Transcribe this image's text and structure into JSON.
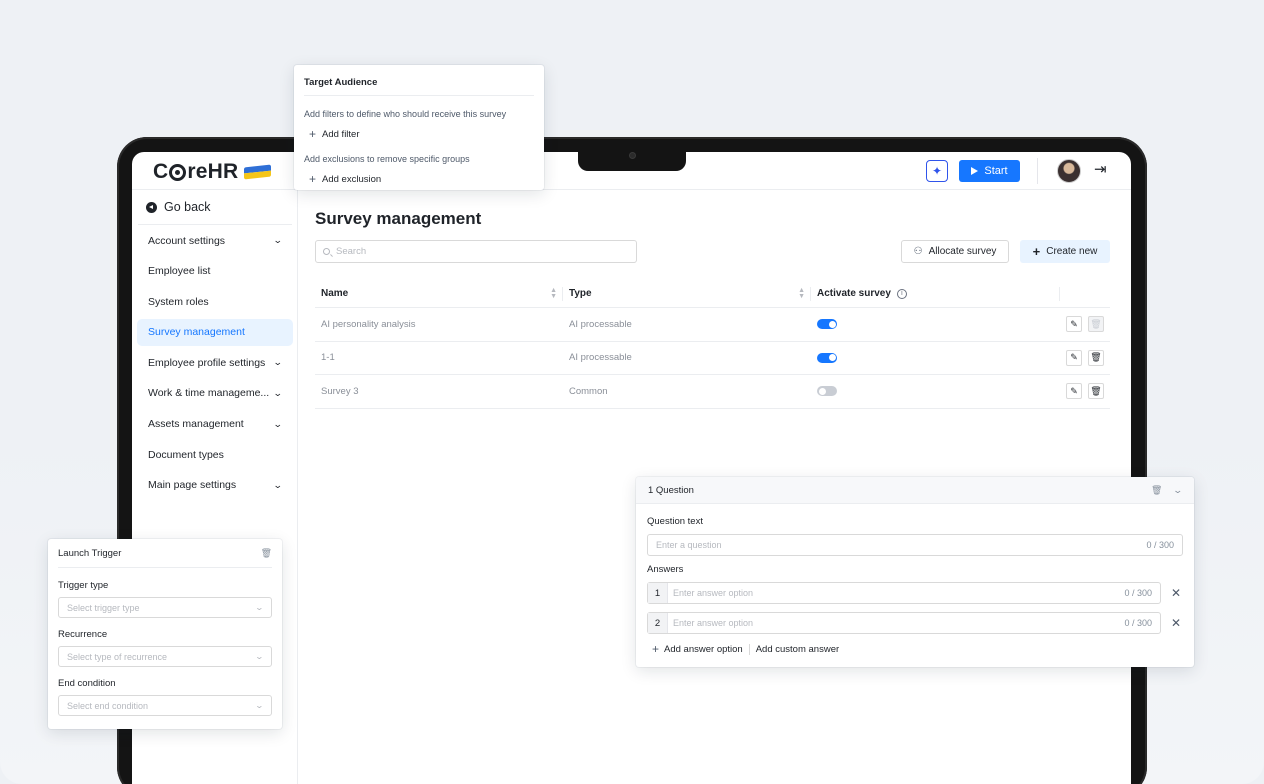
{
  "app": {
    "logo_text_prefix": "C",
    "logo_text_suffix": "reHR"
  },
  "header": {
    "ai_icon": "sparkle-icon",
    "start_label": "Start",
    "logout_icon": "logout-icon"
  },
  "sidebar": {
    "go_back": "Go back",
    "items": [
      {
        "label": "Account settings",
        "has_chevron": true
      },
      {
        "label": "Employee list",
        "has_chevron": false
      },
      {
        "label": "System roles",
        "has_chevron": false
      },
      {
        "label": "Survey management",
        "has_chevron": false,
        "active": true
      },
      {
        "label": "Employee profile settings",
        "has_chevron": true
      },
      {
        "label": "Work & time manageme...",
        "has_chevron": true
      },
      {
        "label": "Assets management",
        "has_chevron": true
      },
      {
        "label": "Document types",
        "has_chevron": false
      },
      {
        "label": "Main page settings",
        "has_chevron": true
      }
    ]
  },
  "main": {
    "title": "Survey management",
    "search_placeholder": "Search",
    "allocate_label": "Allocate survey",
    "create_label": "Create new",
    "table": {
      "columns": [
        "Name",
        "Type",
        "Activate survey"
      ],
      "rows": [
        {
          "name": "AI personality analysis",
          "type": "AI processable",
          "active": true,
          "delete_disabled": true
        },
        {
          "name": "1-1",
          "type": "AI processable",
          "active": true,
          "delete_disabled": false
        },
        {
          "name": "Survey 3",
          "type": "Common",
          "active": false,
          "delete_disabled": false
        }
      ]
    }
  },
  "target_audience": {
    "title": "Target Audience",
    "filters_desc": "Add filters to define who should receive this survey",
    "add_filter": "Add filter",
    "exclusions_desc": "Add exclusions to remove specific groups",
    "add_exclusion": "Add exclusion"
  },
  "launch_trigger": {
    "title": "Launch Trigger",
    "trigger_type_label": "Trigger type",
    "trigger_type_placeholder": "Select trigger type",
    "recurrence_label": "Recurrence",
    "recurrence_placeholder": "Select type of recurrence",
    "end_condition_label": "End condition",
    "end_condition_placeholder": "Select end condition"
  },
  "question": {
    "title": "1 Question",
    "question_text_label": "Question text",
    "question_placeholder": "Enter a question",
    "question_count": "0 / 300",
    "answers_label": "Answers",
    "answers": [
      {
        "num": "1",
        "placeholder": "Enter answer option",
        "count": "0 / 300"
      },
      {
        "num": "2",
        "placeholder": "Enter answer option",
        "count": "0 / 300"
      }
    ],
    "add_answer_option": "Add answer option",
    "add_custom_answer": "Add custom answer"
  }
}
